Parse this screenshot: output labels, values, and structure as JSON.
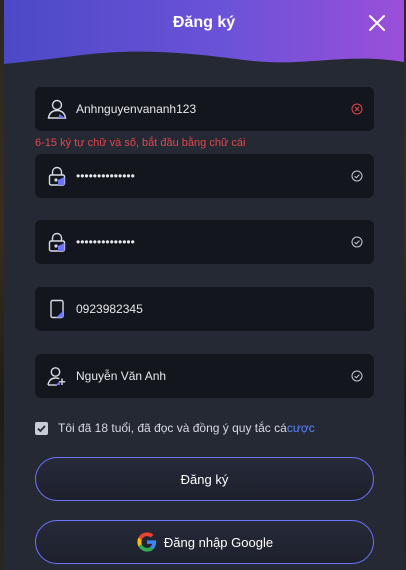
{
  "modal": {
    "title": "Đăng ký",
    "close_icon": "close-icon"
  },
  "fields": {
    "username": {
      "value": "Anhnguyenvananh123",
      "icon": "user-icon",
      "status": "error-icon"
    },
    "username_error": "6-15 ký tự chữ và số, bắt đầu bằng chữ cái",
    "password": {
      "value": "••••••••••••••",
      "icon": "lock-icon",
      "status": "check-icon"
    },
    "confirm_password": {
      "value": "••••••••••••••",
      "icon": "lock-icon",
      "status": "check-icon"
    },
    "phone": {
      "value": "0923982345",
      "icon": "phone-icon"
    },
    "fullname": {
      "value": "Nguyễn Văn Anh",
      "icon": "add-user-icon",
      "status": "check-icon"
    }
  },
  "agreement": {
    "checked": true,
    "text": "Tôi đã 18 tuổi, đã đọc và đồng ý quy tắc cá ",
    "link": "cược"
  },
  "buttons": {
    "register_label": "Đăng ký",
    "google_label": "Đăng nhập Google"
  },
  "colors": {
    "accent": "#6d74ff",
    "header_gradient_start": "#4a49c8",
    "header_gradient_end": "#8b4fd6",
    "error": "#e0474c",
    "link": "#5a86ff"
  }
}
